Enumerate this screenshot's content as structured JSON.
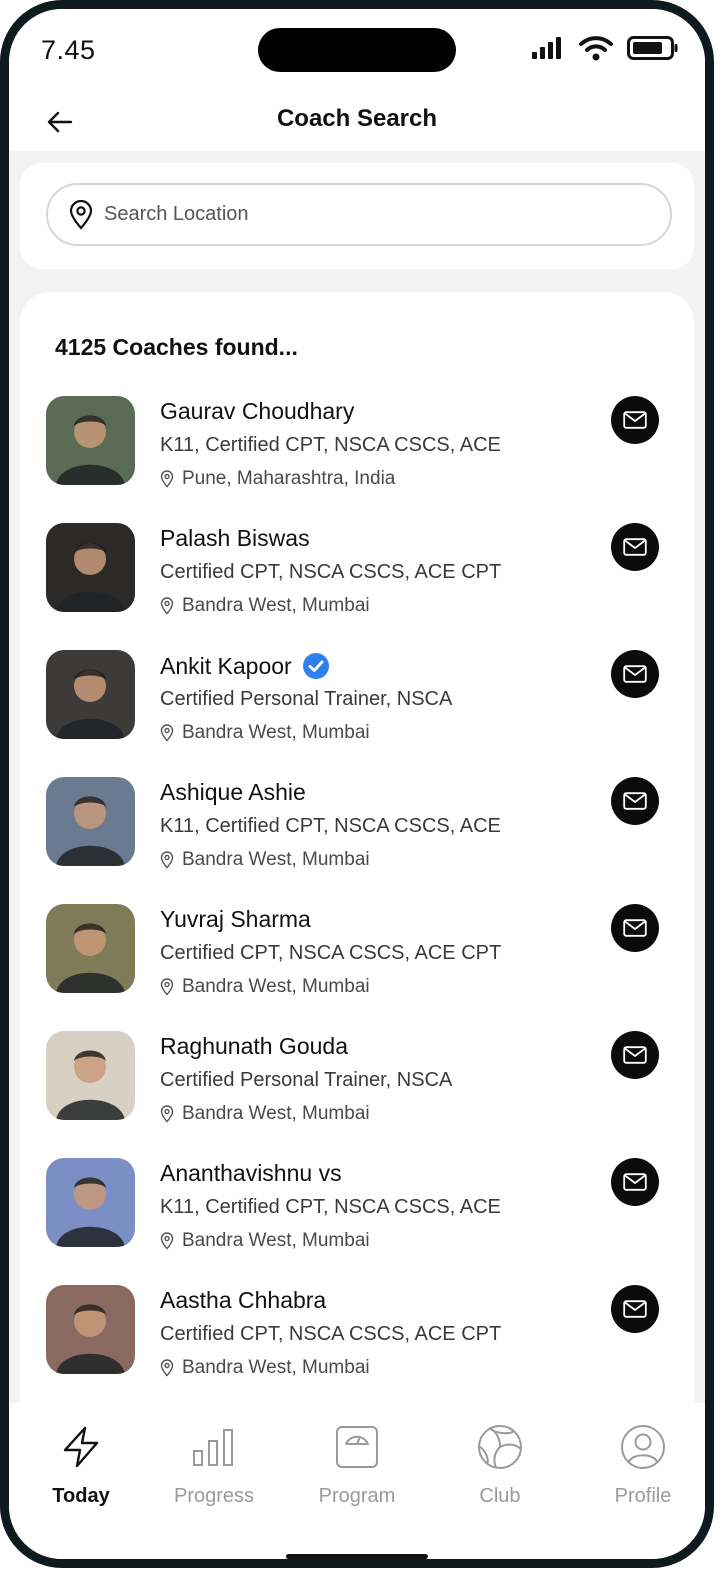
{
  "status_bar": {
    "time": "7.45"
  },
  "header": {
    "title": "Coach Search"
  },
  "search": {
    "placeholder": "Search Location"
  },
  "results": {
    "count_text": "4125 Coaches found..."
  },
  "coaches": [
    {
      "name": "Gaurav Choudhary",
      "credentials": "K11, Certified CPT, NSCA CSCS, ACE",
      "location": "Pune, Maharashtra, India",
      "verified": false,
      "avatar_color": "#5a6b55"
    },
    {
      "name": "Palash Biswas",
      "credentials": "Certified CPT, NSCA CSCS, ACE CPT",
      "location": "Bandra West, Mumbai",
      "verified": false,
      "avatar_color": "#2b2a28"
    },
    {
      "name": "Ankit Kapoor",
      "credentials": "Certified Personal Trainer, NSCA",
      "location": "Bandra West, Mumbai",
      "verified": true,
      "avatar_color": "#3c3b3a"
    },
    {
      "name": "Ashique Ashie",
      "credentials": "K11, Certified CPT, NSCA CSCS, ACE",
      "location": "Bandra West, Mumbai",
      "verified": false,
      "avatar_color": "#6a7a90"
    },
    {
      "name": "Yuvraj Sharma",
      "credentials": "Certified CPT, NSCA CSCS, ACE CPT",
      "location": "Bandra West, Mumbai",
      "verified": false,
      "avatar_color": "#7f7a58"
    },
    {
      "name": "Raghunath Gouda",
      "credentials": "Certified Personal Trainer, NSCA",
      "location": "Bandra West, Mumbai",
      "verified": false,
      "avatar_color": "#d9d0c4"
    },
    {
      "name": "Ananthavishnu vs",
      "credentials": "K11, Certified CPT, NSCA CSCS, ACE",
      "location": "Bandra West, Mumbai",
      "verified": false,
      "avatar_color": "#7b8fc4"
    },
    {
      "name": "Aastha Chhabra",
      "credentials": "Certified CPT, NSCA CSCS, ACE CPT",
      "location": "Bandra West, Mumbai",
      "verified": false,
      "avatar_color": "#8a6a60"
    }
  ],
  "tabbar": {
    "tabs": [
      {
        "label": "Today",
        "icon": "lightning-icon",
        "active": true
      },
      {
        "label": "Progress",
        "icon": "bar-chart-icon",
        "active": false
      },
      {
        "label": "Program",
        "icon": "scale-icon",
        "active": false
      },
      {
        "label": "Club",
        "icon": "volleyball-icon",
        "active": false
      },
      {
        "label": "Profile",
        "icon": "user-icon",
        "active": false
      }
    ]
  },
  "colors": {
    "accent": "#111111",
    "verified_blue": "#2f80ed",
    "inactive_tab": "#9a9a9a"
  }
}
